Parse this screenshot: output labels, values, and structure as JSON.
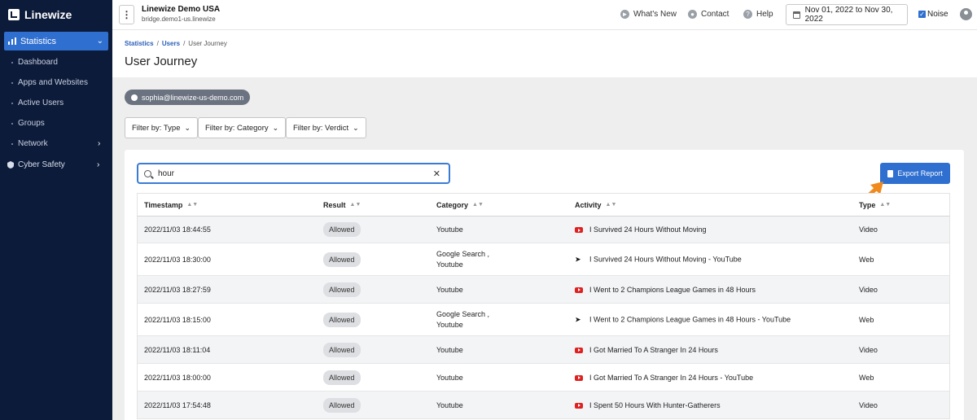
{
  "brand": {
    "name": "Linewize"
  },
  "sidebar": {
    "active": {
      "label": "Statistics"
    },
    "sub_items": [
      {
        "label": "Dashboard"
      },
      {
        "label": "Apps and Websites"
      },
      {
        "label": "Active Users"
      },
      {
        "label": "Groups"
      },
      {
        "label": "Network"
      }
    ],
    "cyber_safety": {
      "label": "Cyber Safety"
    }
  },
  "header": {
    "org_name": "Linewize Demo USA",
    "org_host": "bridge.demo1-us.linewize",
    "whats_new": "What's New",
    "contact": "Contact",
    "help": "Help",
    "date_range": "Nov 01, 2022 to Nov 30, 2022",
    "noise_label": "Noise"
  },
  "breadcrumb": {
    "statistics": "Statistics",
    "users": "Users",
    "current": "User Journey"
  },
  "page_title": "User Journey",
  "user_chip": "sophia@linewize-us-demo.com",
  "filters": {
    "type": "Filter by: Type",
    "category": "Filter by: Category",
    "verdict": "Filter by: Verdict"
  },
  "search": {
    "value": "hour"
  },
  "export_label": "Export Report",
  "table": {
    "headers": {
      "timestamp": "Timestamp",
      "result": "Result",
      "category": "Category",
      "activity": "Activity",
      "type": "Type"
    },
    "rows": [
      {
        "timestamp": "2022/11/03 18:44:55",
        "result": "Allowed",
        "category1": "Youtube",
        "category2": "",
        "activity": "I Survived 24 Hours Without Moving",
        "icon": "youtube-icon",
        "type": "Video"
      },
      {
        "timestamp": "2022/11/03 18:30:00",
        "result": "Allowed",
        "category1": "Google Search ,",
        "category2": "Youtube",
        "activity": "I Survived 24 Hours Without Moving - YouTube",
        "icon": "cursor-icon",
        "type": "Web"
      },
      {
        "timestamp": "2022/11/03 18:27:59",
        "result": "Allowed",
        "category1": "Youtube",
        "category2": "",
        "activity": "I Went to 2 Champions League Games in 48 Hours",
        "icon": "youtube-icon",
        "type": "Video"
      },
      {
        "timestamp": "2022/11/03 18:15:00",
        "result": "Allowed",
        "category1": "Google Search ,",
        "category2": "Youtube",
        "activity": "I Went to 2 Champions League Games in 48 Hours - YouTube",
        "icon": "cursor-icon",
        "type": "Web"
      },
      {
        "timestamp": "2022/11/03 18:11:04",
        "result": "Allowed",
        "category1": "Youtube",
        "category2": "",
        "activity": "I Got Married To A Stranger In 24 Hours",
        "icon": "youtube-icon",
        "type": "Video"
      },
      {
        "timestamp": "2022/11/03 18:00:00",
        "result": "Allowed",
        "category1": "Youtube",
        "category2": "",
        "activity": "I Got Married To A Stranger In 24 Hours - YouTube",
        "icon": "youtube-icon",
        "type": "Web"
      },
      {
        "timestamp": "2022/11/03 17:54:48",
        "result": "Allowed",
        "category1": "Youtube",
        "category2": "",
        "activity": "I Spent 50 Hours With Hunter-Gatherers",
        "icon": "youtube-icon",
        "type": "Video"
      }
    ]
  },
  "colors": {
    "sidebar": "#0d1b3a",
    "accent": "#2f6fd0",
    "annotation_arrow": "#f08a1c"
  }
}
